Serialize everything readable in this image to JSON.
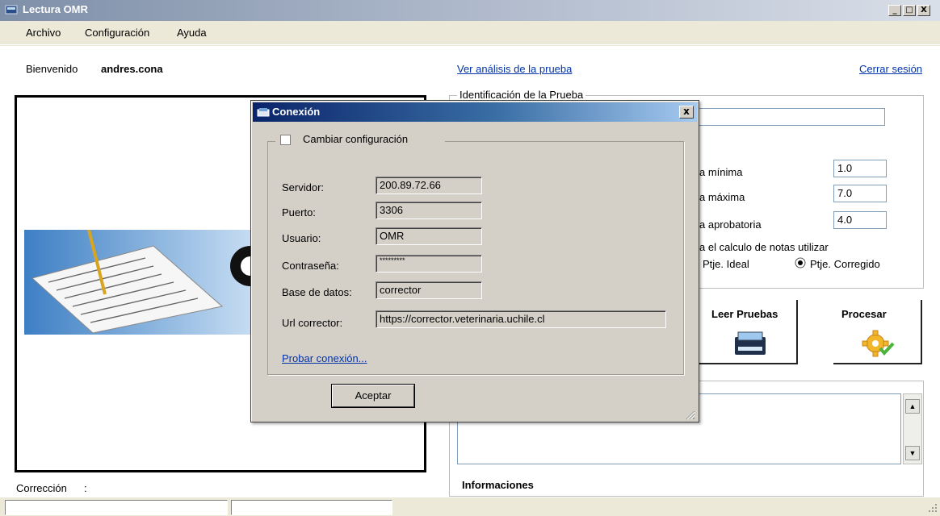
{
  "window": {
    "title": "Lectura OMR",
    "icon": "scanner-icon"
  },
  "window_buttons": {
    "minimize": "_",
    "maximize": "□",
    "close": "X"
  },
  "menu": [
    {
      "label": "Archivo"
    },
    {
      "label": "Configuración"
    },
    {
      "label": "Ayuda"
    }
  ],
  "header": {
    "welcome_label": "Bienvenido",
    "username": "andres.cona",
    "analysis_link": "Ver análisis de la prueba",
    "logout_link": "Cerrar sesión"
  },
  "test_id": {
    "legend": "Identificación de la Prueba",
    "name_value": "",
    "settings": [
      {
        "label": "a mínima",
        "value": "1.0"
      },
      {
        "label": "a máxima",
        "value": "7.0"
      },
      {
        "label": "a aprobatoria",
        "value": "4.0"
      }
    ],
    "calc_label": "a el calculo de notas utilizar",
    "radio_ideal": "Ptje. Ideal",
    "radio_corregido": "Ptje. Corregido",
    "selected": "Ptje. Corregido"
  },
  "actions": {
    "read_label": "Leer Pruebas",
    "read_icon": "scanner-icon",
    "process_label": "Procesar",
    "process_icon": "gear-check-icon"
  },
  "info": {
    "label": "Informaciones",
    "text": ""
  },
  "correction": {
    "label": "Corrección",
    "value": ":"
  },
  "status": {
    "cell1": "",
    "cell2": ""
  },
  "dialog": {
    "title": "Conexión",
    "icon": "scanner-icon",
    "close": "x",
    "change_config_label": "Cambiar configuración",
    "change_config_checked": false,
    "fields": [
      {
        "label": "Servidor:",
        "value": "200.89.72.66"
      },
      {
        "label": "Puerto:",
        "value": "3306"
      },
      {
        "label": "Usuario:",
        "value": "OMR"
      },
      {
        "label": "Contraseña:",
        "value": "*********"
      },
      {
        "label": "Base de datos:",
        "value": "corrector"
      },
      {
        "label": "Url corrector:",
        "value": "https://corrector.veterinaria.uchile.cl"
      }
    ],
    "test_link": "Probar conexión...",
    "accept_button": "Aceptar"
  },
  "colors": {
    "link": "#0033aa",
    "dialog_title": "#0a246a",
    "window_bg": "#ece9d8"
  }
}
